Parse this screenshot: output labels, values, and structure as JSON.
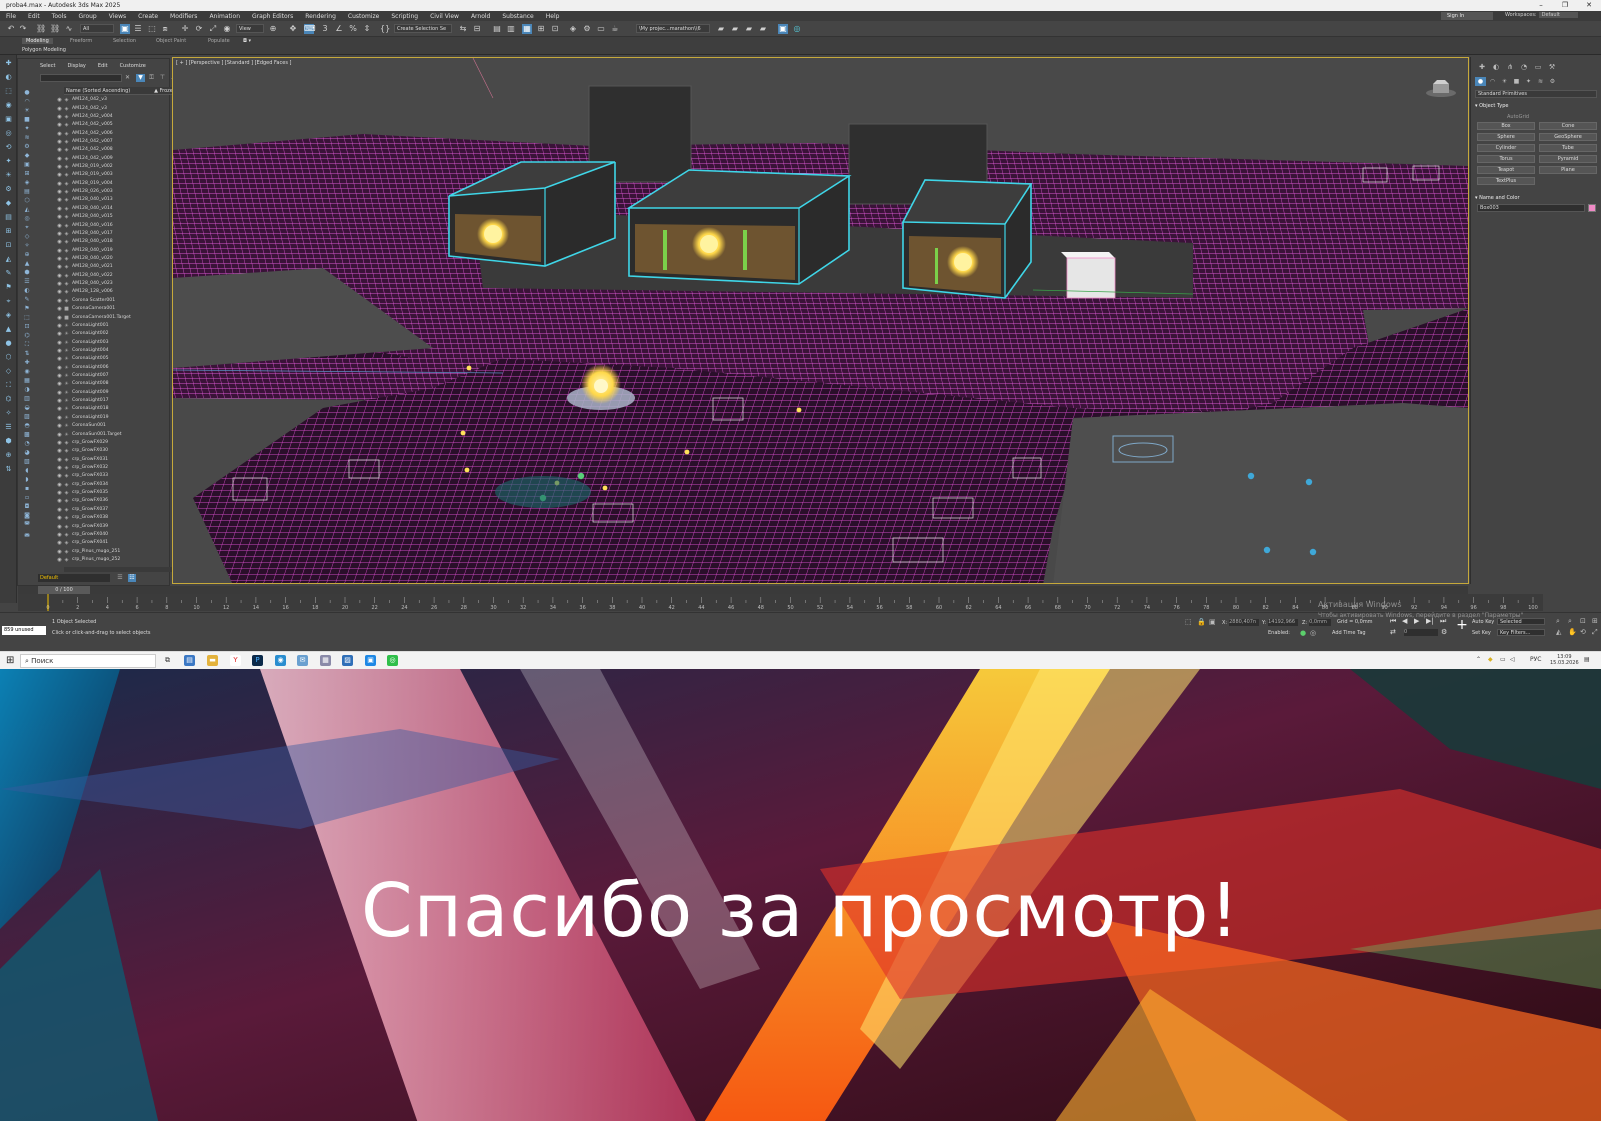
{
  "window": {
    "title": "proba4.max - Autodesk 3ds Max 2025",
    "controls": [
      "–",
      "❐",
      "✕"
    ]
  },
  "menu": [
    "File",
    "Edit",
    "Tools",
    "Group",
    "Views",
    "Create",
    "Modifiers",
    "Animation",
    "Graph Editors",
    "Rendering",
    "Customize",
    "Scripting",
    "Civil View",
    "Arnold",
    "Substance",
    "Help"
  ],
  "signin": "Sign In",
  "workspace": {
    "label": "Workspaces:",
    "value": "Default"
  },
  "toolbar": {
    "filter": "All",
    "refcoord": "View",
    "selection_set": "Create Selection Se",
    "project": "\\My projec...marathon\\\\6"
  },
  "ribbon": {
    "tabs": [
      "Modeling",
      "Freeform",
      "Selection",
      "Object Paint",
      "Populate"
    ],
    "sub": "Polygon Modeling"
  },
  "explorer": {
    "tabs": [
      "Select",
      "Display",
      "Edit",
      "Customize"
    ],
    "column": "Name (Sorted Ascending)",
    "frozen": "▲ Frozen",
    "items": [
      "AM124_042_v3",
      "AM124_042_v3",
      "AM124_042_v004",
      "AM124_042_v005",
      "AM124_042_v006",
      "AM124_042_v007",
      "AM124_042_v008",
      "AM124_042_v009",
      "AM128_019_v002",
      "AM128_019_v003",
      "AM128_019_v004",
      "AM128_026_v003",
      "AM128_040_v013",
      "AM128_040_v014",
      "AM128_040_v015",
      "AM128_040_v016",
      "AM128_040_v017",
      "AM128_040_v018",
      "AM128_040_v019",
      "AM128_040_v020",
      "AM128_040_v021",
      "AM128_040_v022",
      "AM128_040_v023",
      "AM128_128_v006",
      "Corona Scatter001",
      "CoronaCamera001",
      "CoronaCamera001.Target",
      "CoronaLight001",
      "CoronaLight002",
      "CoronaLight003",
      "CoronaLight004",
      "CoronaLight005",
      "CoronaLight006",
      "CoronaLight007",
      "CoronaLight008",
      "CoronaLight009",
      "CoronaLight017",
      "CoronaLight018",
      "CoronaLight019",
      "CoronaSun001",
      "CoronaSun001.Target",
      "crp_GrowFX029",
      "crp_GrowFX030",
      "crp_GrowFX031",
      "crp_GrowFX032",
      "crp_GrowFX033",
      "crp_GrowFX034",
      "crp_GrowFX035",
      "crp_GrowFX036",
      "crp_GrowFX037",
      "crp_GrowFX038",
      "crp_GrowFX039",
      "crp_GrowFX040",
      "crp_GrowFX041",
      "crp_Pinus_mugo_251",
      "crp_Pinus_mugo_252",
      "crp_Pinus_mugo_253"
    ],
    "layer": "Default"
  },
  "viewport": {
    "label": "[ + ] [Perspective ] [Standard ] [Edged Faces ]",
    "wire_color": "#d24bc7",
    "select_color": "#3fd6e8"
  },
  "command_panel": {
    "category": "Standard Primitives",
    "object_type_title": "Object Type",
    "autogrid": "AutoGrid",
    "buttons": [
      "Box",
      "Cone",
      "Sphere",
      "GeoSphere",
      "Cylinder",
      "Tube",
      "Torus",
      "Pyramid",
      "Teapot",
      "Plane",
      "TextPlus"
    ],
    "name_color_title": "Name and Color",
    "object_name": "Box003",
    "object_color": "#f08ac6"
  },
  "timeline": {
    "position": "0 / 100",
    "ticks": [
      "0",
      "2",
      "4",
      "6",
      "8",
      "10",
      "12",
      "14",
      "16",
      "18",
      "20",
      "22",
      "24",
      "26",
      "28",
      "30",
      "32",
      "34",
      "36",
      "38",
      "40",
      "42",
      "44",
      "46",
      "48",
      "50",
      "52",
      "54",
      "56",
      "58",
      "60",
      "62",
      "64",
      "66",
      "68",
      "70",
      "72",
      "74",
      "76",
      "78",
      "80",
      "82",
      "84",
      "86",
      "88",
      "90",
      "92",
      "94",
      "96",
      "98",
      "100"
    ]
  },
  "status": {
    "maxscript": "859 unused",
    "selected": "1 Object Selected",
    "hint": "Click or click-and-drag to select objects",
    "x_label": "X:",
    "x_value": "2880,407n",
    "y_label": "Y:",
    "y_value": "14192,966",
    "z_label": "Z:",
    "z_value": "0,0mm",
    "grid": "Grid = 0,0mm",
    "enabled": "Enabled:",
    "add_time_tag": "Add Time Tag",
    "auto_key": "Auto Key",
    "set_key": "Set Key",
    "selected_dd": "Selected",
    "key_filters": "Key Filters...",
    "frame": "0"
  },
  "activation": {
    "line1": "Активация Windows",
    "line2": "Чтобы активировать Windows, перейдите в раздел \"Параметры\""
  },
  "taskbar": {
    "search": "Поиск",
    "lang": "РУС",
    "time": "13:09",
    "date": "15.03.2026"
  },
  "slide": {
    "text": "Спасибо за просмотр!"
  }
}
